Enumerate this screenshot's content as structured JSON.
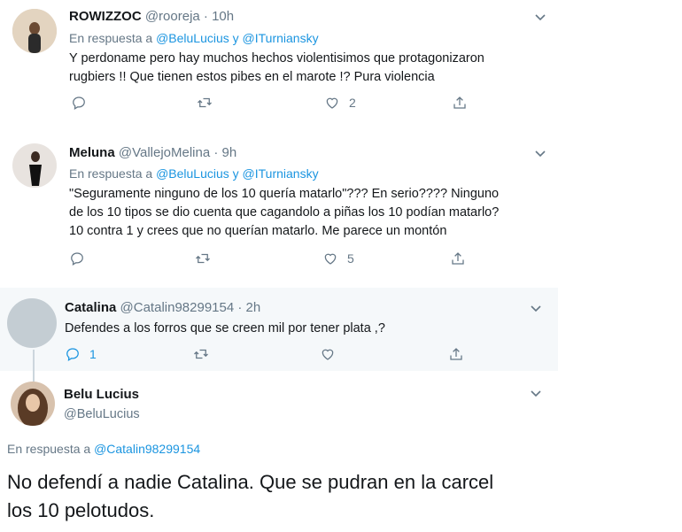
{
  "tweets": [
    {
      "name": "ROWIZZOC",
      "handle": "@rooreja",
      "time": " · 10h",
      "reply_prefix": "En respuesta a ",
      "reply_targets": "@BeluLucius y @ITurniansky",
      "lines": [
        "Y perdoname pero hay muchos hechos violentisimos que protagonizaron",
        "rugbiers !! Que tienen estos pibes en el marote !? Pura violencia"
      ],
      "likes": "2"
    },
    {
      "name": "Meluna",
      "handle": "@VallejoMelina",
      "time": " · 9h",
      "reply_prefix": "En respuesta a ",
      "reply_targets": "@BeluLucius y @ITurniansky",
      "lines": [
        "\"Seguramente ninguno de los 10 quería matarlo\"??? En serio???? Ninguno",
        "de los 10 tipos se dio cuenta que cagandolo a piñas los 10 podían matarlo?",
        "10 contra 1 y crees que no querían matarlo. Me parece un montón"
      ],
      "likes": "5"
    },
    {
      "name": "Catalina",
      "handle": "@Catalin98299154",
      "time": " · 2h",
      "lines": [
        "Defendes a los forros que se creen mil por tener plata ,?"
      ],
      "replies": "1"
    }
  ],
  "main_tweet": {
    "name": "Belu Lucius",
    "handle": "@BeluLucius",
    "reply_prefix": "En respuesta a ",
    "reply_target": "@Catalin98299154",
    "lines": [
      "No defendí a nadie Catalina. Que se pudran en la carcel",
      "los 10 pelotudos."
    ]
  },
  "colors": {
    "accent": "#1b95e0",
    "muted": "#657786",
    "highlight_bg": "#f5f8fa"
  }
}
